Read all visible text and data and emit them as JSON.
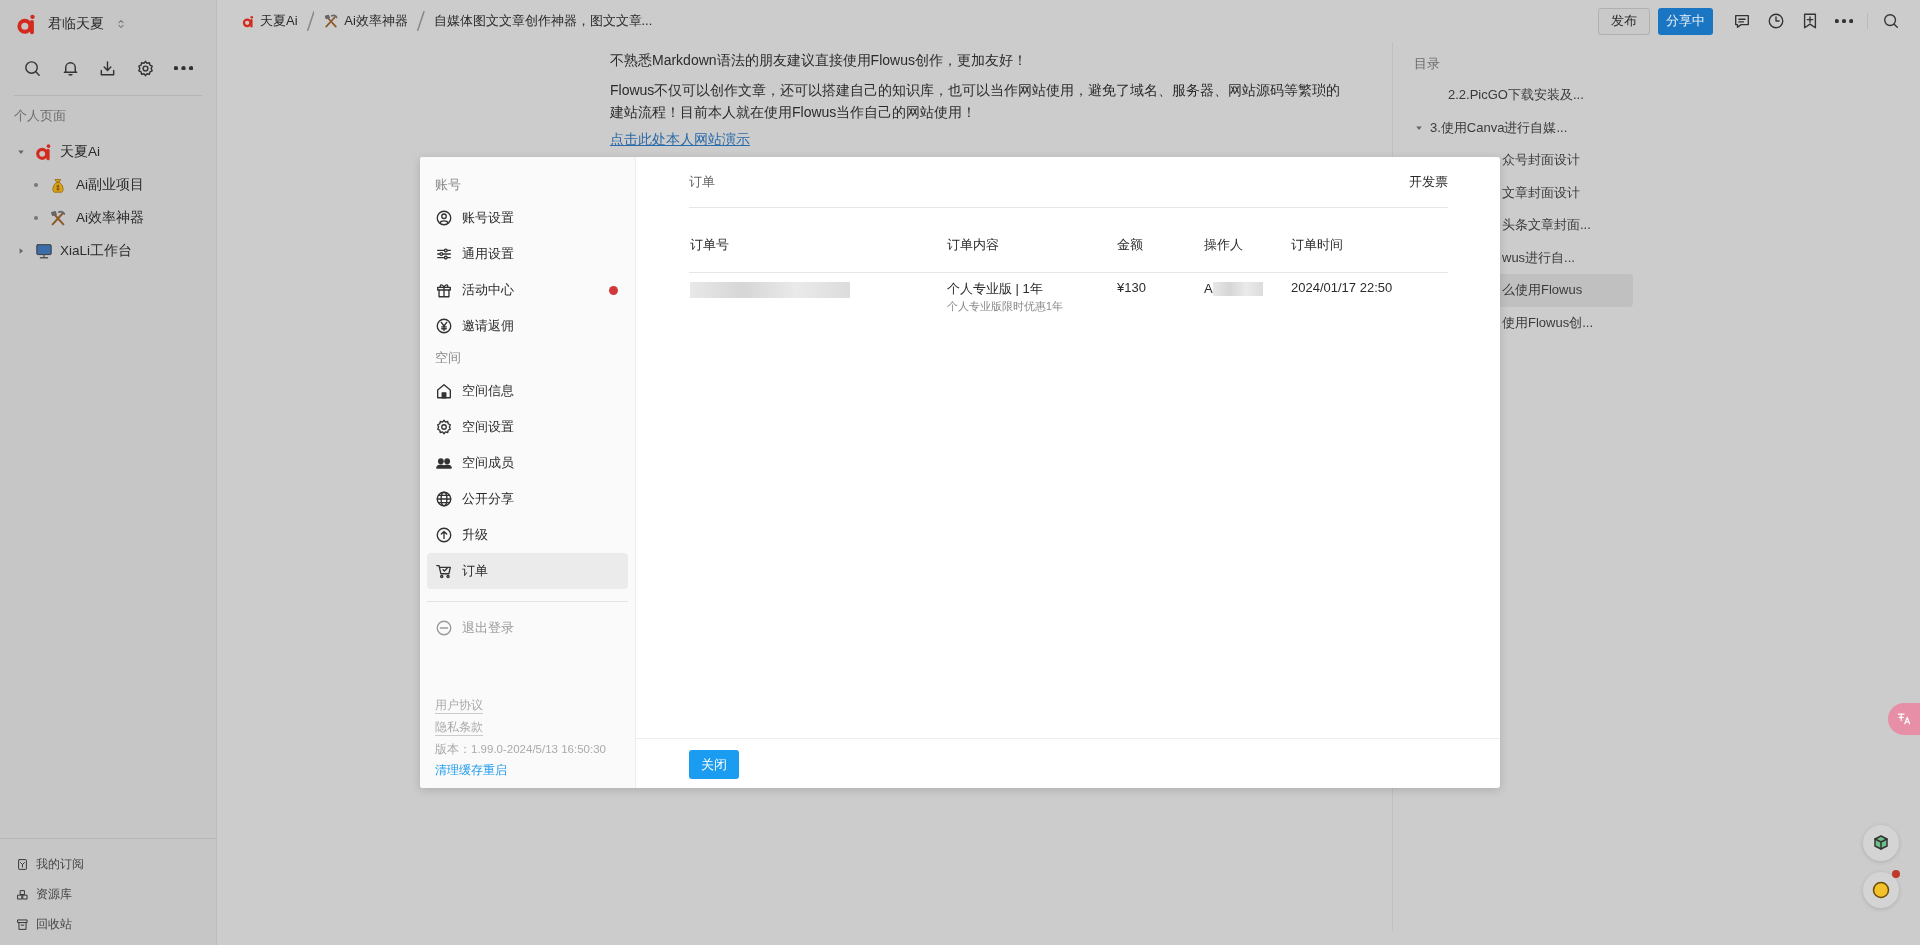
{
  "sidebar": {
    "workspace": "君临天夏",
    "section_label": "个人页面",
    "tree": [
      {
        "label": "天夏Ai",
        "expanded": true,
        "children": [
          {
            "label": "Ai副业项目"
          },
          {
            "label": "Ai效率神器"
          }
        ]
      },
      {
        "label": "XiaLi工作台",
        "expanded": false
      }
    ],
    "footer_items": [
      "我的订阅",
      "资源库",
      "回收站"
    ]
  },
  "breadcrumb": [
    "天夏Ai",
    "Ai效率神器",
    "自媒体图文文章创作神器，图文文章..."
  ],
  "toolbar": {
    "publish": "发布",
    "share": "分享中"
  },
  "content": {
    "paragraphs": [
      "不熟悉Markdown语法的朋友建议直接使用Flowus创作，更加友好！",
      "Flowus不仅可以创作文章，还可以搭建自己的知识库，也可以当作网站使用，避免了域名、服务器、网站源码等繁琐的建站流程！目前本人就在使用Flowus当作自己的网站使用！"
    ],
    "link": "点击此处本人网站演示"
  },
  "toc": {
    "title": "目录",
    "items": [
      {
        "text": "2.2.PicGO下载安装及...",
        "selected": false,
        "cut": false
      },
      {
        "text": "3.使用Canva进行自媒...",
        "selected": false,
        "cut": false,
        "expanded": true,
        "children": [
          {
            "text": "众号封面设计",
            "selected": false,
            "cut": true
          },
          {
            "text": "文章封面设计",
            "selected": false,
            "cut": true
          },
          {
            "text": "头条文章封面...",
            "selected": false,
            "cut": true
          }
        ]
      },
      {
        "text": "wus进行自...",
        "selected": false,
        "cut": true
      },
      {
        "text": "么使用Flowus",
        "selected": true,
        "cut": true
      },
      {
        "text": "使用Flowus创...",
        "selected": false,
        "cut": true
      }
    ]
  },
  "settings": {
    "groups": [
      {
        "label": "账号",
        "items": [
          {
            "label": "账号设置",
            "selected": false,
            "notification": false
          },
          {
            "label": "通用设置",
            "selected": false,
            "notification": false
          },
          {
            "label": "活动中心",
            "selected": false,
            "notification": true
          },
          {
            "label": "邀请返佣",
            "selected": false,
            "notification": false
          }
        ]
      },
      {
        "label": "空间",
        "items": [
          {
            "label": "空间信息",
            "selected": false,
            "notification": false
          },
          {
            "label": "空间设置",
            "selected": false,
            "notification": false
          },
          {
            "label": "空间成员",
            "selected": false,
            "notification": false
          },
          {
            "label": "公开分享",
            "selected": false,
            "notification": false
          },
          {
            "label": "升级",
            "selected": false,
            "notification": false
          },
          {
            "label": "订单",
            "selected": true,
            "notification": false
          }
        ]
      }
    ],
    "logout": "退出登录",
    "links": [
      "用户协议",
      "隐私条款"
    ],
    "version": "版本：1.99.0-2024/5/13 16:50:30",
    "restart": "清理缓存重启"
  },
  "orders": {
    "title": "订单",
    "invoice": "开发票",
    "columns": [
      "订单号",
      "订单内容",
      "金额",
      "操作人",
      "订单时间"
    ],
    "rows": [
      {
        "order_no": {
          "redacted": true
        },
        "content": "个人专业版 | 1年",
        "note": "个人专业版限时优惠1年",
        "amount": "¥130",
        "operator": {
          "text": "A",
          "redacted": true
        },
        "time": "2024/01/17 22:50"
      }
    ],
    "close": "关闭"
  }
}
